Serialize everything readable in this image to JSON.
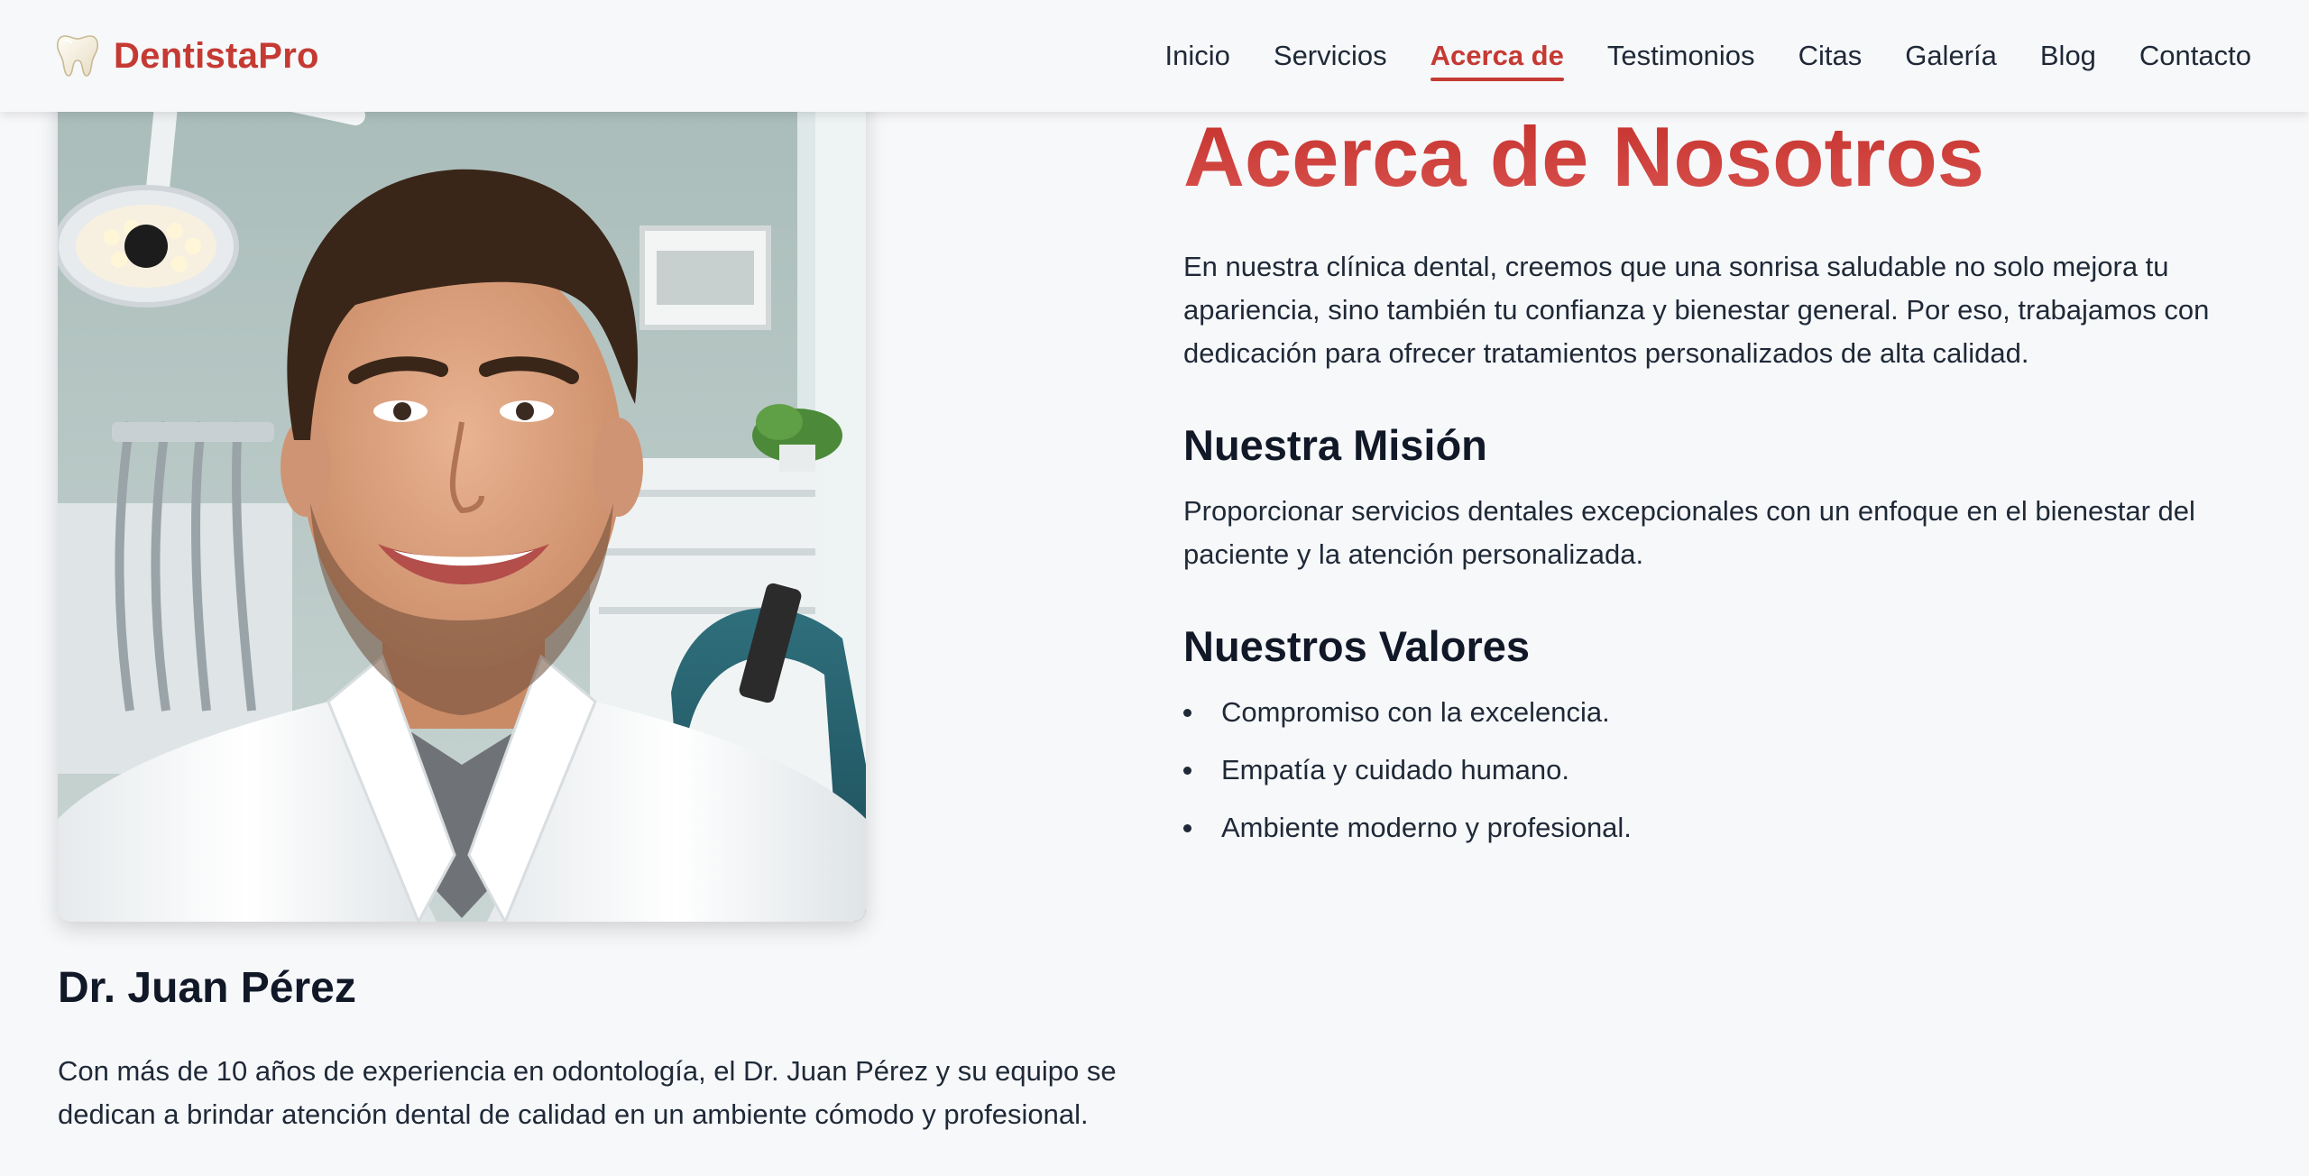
{
  "header": {
    "brand": "DentistaPro",
    "brand_icon": "tooth-icon",
    "nav": [
      {
        "label": "Inicio"
      },
      {
        "label": "Servicios"
      },
      {
        "label": "Acerca de"
      },
      {
        "label": "Testimonios"
      },
      {
        "label": "Citas"
      },
      {
        "label": "Galería"
      },
      {
        "label": "Blog"
      },
      {
        "label": "Contacto"
      }
    ],
    "active_nav": "Acerca de"
  },
  "doctor": {
    "photo": "smiling-dentist-photo",
    "name": "Dr. Juan Pérez",
    "bio": "Con más de 10 años de experiencia en odontología, el Dr. Juan Pérez y su equipo se dedican a brindar atención dental de calidad en un ambiente cómodo y profesional."
  },
  "about": {
    "title": "Acerca de Nosotros",
    "intro": "En nuestra clínica dental, creemos que una sonrisa saludable no solo mejora tu apariencia, sino también tu confianza y bienestar general. Por eso, trabajamos con dedicación para ofrecer tratamientos personalizados de alta calidad.",
    "mission_title": "Nuestra Misión",
    "mission_text": "Proporcionar servicios dentales excepcionales con un enfoque en el bienestar del paciente y la atención personalizada.",
    "values_title": "Nuestros Valores",
    "values": [
      "Compromiso con la excelencia.",
      "Empatía y cuidado humano.",
      "Ambiente moderno y profesional."
    ]
  },
  "colors": {
    "accent": "#c53a33",
    "text": "#1f2937",
    "background": "#f7f8fa"
  }
}
